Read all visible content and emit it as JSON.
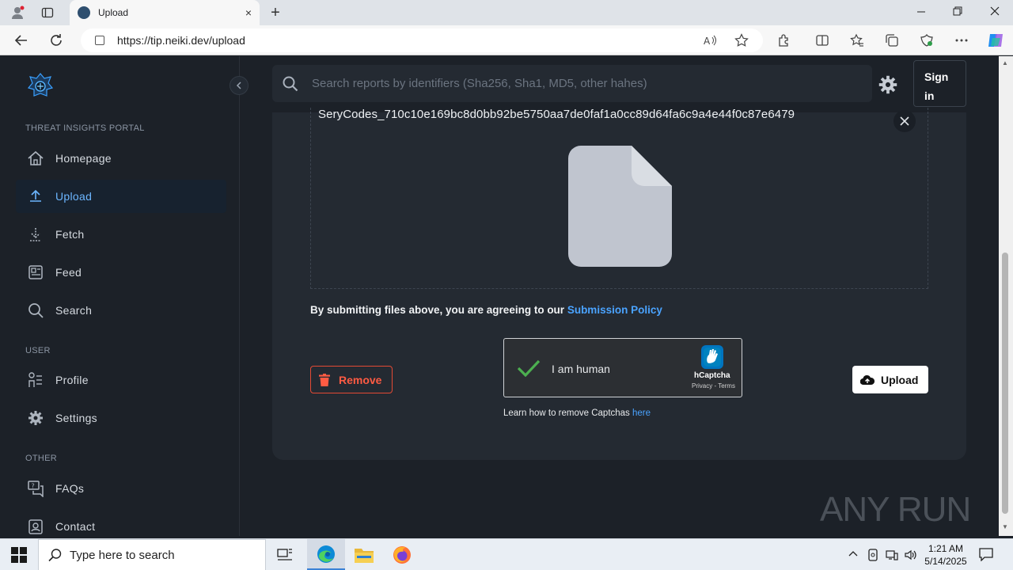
{
  "browser": {
    "tab_title": "Upload",
    "url": "https://tip.neiki.dev/upload",
    "new_tab_symbol": "+",
    "close_tab_symbol": "×"
  },
  "sidebar": {
    "section_portal": "THREAT INSIGHTS PORTAL",
    "section_user": "USER",
    "section_other": "OTHER",
    "items": [
      {
        "label": "Homepage",
        "icon": "home-icon"
      },
      {
        "label": "Upload",
        "icon": "upload-icon",
        "active": true
      },
      {
        "label": "Fetch",
        "icon": "download-icon"
      },
      {
        "label": "Feed",
        "icon": "feed-icon"
      },
      {
        "label": "Search",
        "icon": "search-icon"
      },
      {
        "label": "Profile",
        "icon": "profile-icon"
      },
      {
        "label": "Settings",
        "icon": "gear-icon"
      },
      {
        "label": "FAQs",
        "icon": "faq-icon"
      },
      {
        "label": "Contact",
        "icon": "contact-icon"
      }
    ]
  },
  "header": {
    "search_placeholder": "Search reports by identifiers (Sha256, Sha1, MD5, other hahes)",
    "signin_line1": "Sign",
    "signin_line2": "in"
  },
  "upload": {
    "file_name": "SeryCodes_710c10e169bc8d0bb92be5750aa7de0faf1a0cc89d64fa6c9a4e44f0c87e6479",
    "policy_text": "By submitting files above, you are agreeing to our ",
    "policy_link": "Submission Policy",
    "remove_label": "Remove",
    "upload_label": "Upload",
    "captcha_label": "I am human",
    "captcha_brand": "hCaptcha",
    "captcha_terms": "Privacy - Terms",
    "learn_text": "Learn how to remove Captchas ",
    "learn_link": "here"
  },
  "watermark": "ANY RUN",
  "taskbar": {
    "search_placeholder": "Type here to search",
    "time": "1:21 AM",
    "date": "5/14/2025"
  },
  "colors": {
    "accent": "#4aa3ff",
    "danger": "#ff5b43",
    "background": "#1c2128",
    "panel": "#242a32"
  }
}
